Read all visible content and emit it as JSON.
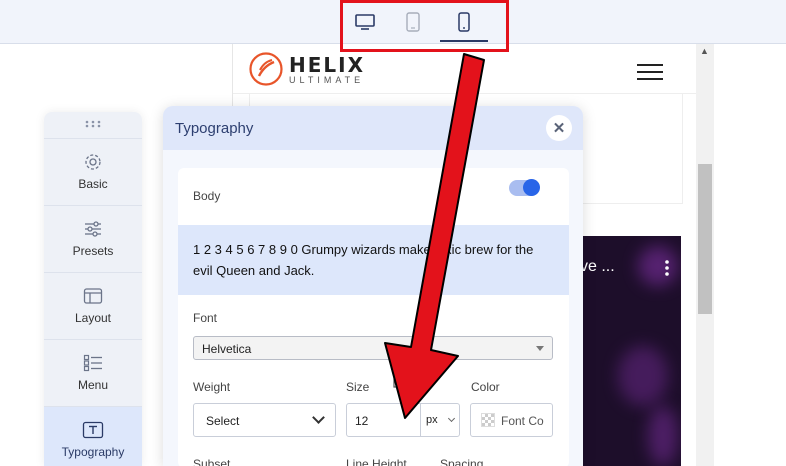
{
  "device_bar": {
    "devices": [
      {
        "name": "desktop",
        "icon": "desktop-icon"
      },
      {
        "name": "tablet",
        "icon": "tablet-icon"
      },
      {
        "name": "mobile",
        "icon": "mobile-icon",
        "active": true
      }
    ],
    "highlight_color": "#e3121b"
  },
  "site": {
    "logo_text": "HELIX",
    "logo_sub": "ULTIMATE",
    "media_title": "ve ...",
    "brand_color": "#e8552a"
  },
  "sidebar": {
    "items": [
      {
        "label": "Basic",
        "icon": "gear-icon"
      },
      {
        "label": "Presets",
        "icon": "sliders-icon"
      },
      {
        "label": "Layout",
        "icon": "layout-icon"
      },
      {
        "label": "Menu",
        "icon": "menu-list-icon"
      },
      {
        "label": "Typography",
        "icon": "text-icon",
        "active": true
      }
    ]
  },
  "panel": {
    "title": "Typography",
    "section": "Body",
    "enabled": true,
    "sample_text": "1 2 3 4 5 6 7 8 9 0 Grumpy wizards make toxic brew for the evil Queen and Jack.",
    "font_label": "Font",
    "font_value": "Helvetica",
    "weight_label": "Weight",
    "weight_value": "Select",
    "size_label": "Size",
    "size_value": "12",
    "size_unit": "px",
    "color_label": "Color",
    "color_button": "Font Co",
    "subset_label": "Subset",
    "line_height_label": "Line Height",
    "spacing_label": "Spacing"
  }
}
